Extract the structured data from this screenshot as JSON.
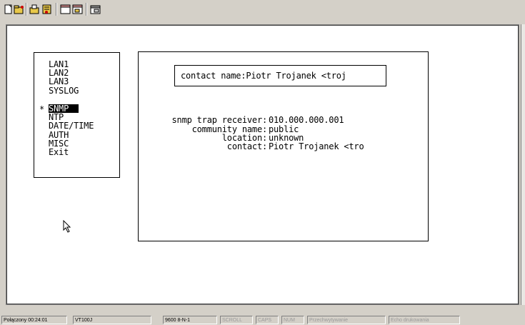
{
  "toolbar": {
    "buttons": [
      "new-icon",
      "open-icon",
      "disconnect-icon",
      "connect-icon",
      "send-icon",
      "receive-icon",
      "properties-icon"
    ]
  },
  "menu": {
    "marker": "*",
    "items": [
      {
        "label": "LAN1"
      },
      {
        "label": "LAN2"
      },
      {
        "label": "LAN3"
      },
      {
        "label": "SYSLOG"
      },
      {
        "label": "SNMP",
        "selected": true
      },
      {
        "label": "NTP"
      },
      {
        "label": "DATE/TIME"
      },
      {
        "label": "AUTH"
      },
      {
        "label": "MISC"
      },
      {
        "label": "Exit"
      }
    ]
  },
  "panel": {
    "input_text": "contact name:Piotr Trojanek <troj",
    "fields": [
      {
        "label": "snmp trap receiver:",
        "value": "010.000.000.001"
      },
      {
        "label": "community name:",
        "value": "public"
      },
      {
        "label": "location:",
        "value": "unknown"
      },
      {
        "label": "contact:",
        "value": "Piotr Trojanek <tro"
      }
    ]
  },
  "statusbar": {
    "connected": "Połączony 00:24:01",
    "emulation": "VT100J",
    "settings": "9600 8-N-1",
    "scroll": "SCROLL",
    "caps": "CAPS",
    "num": "NUM",
    "capture": "Przechwytywanie",
    "echo": "Echo drukowania"
  }
}
